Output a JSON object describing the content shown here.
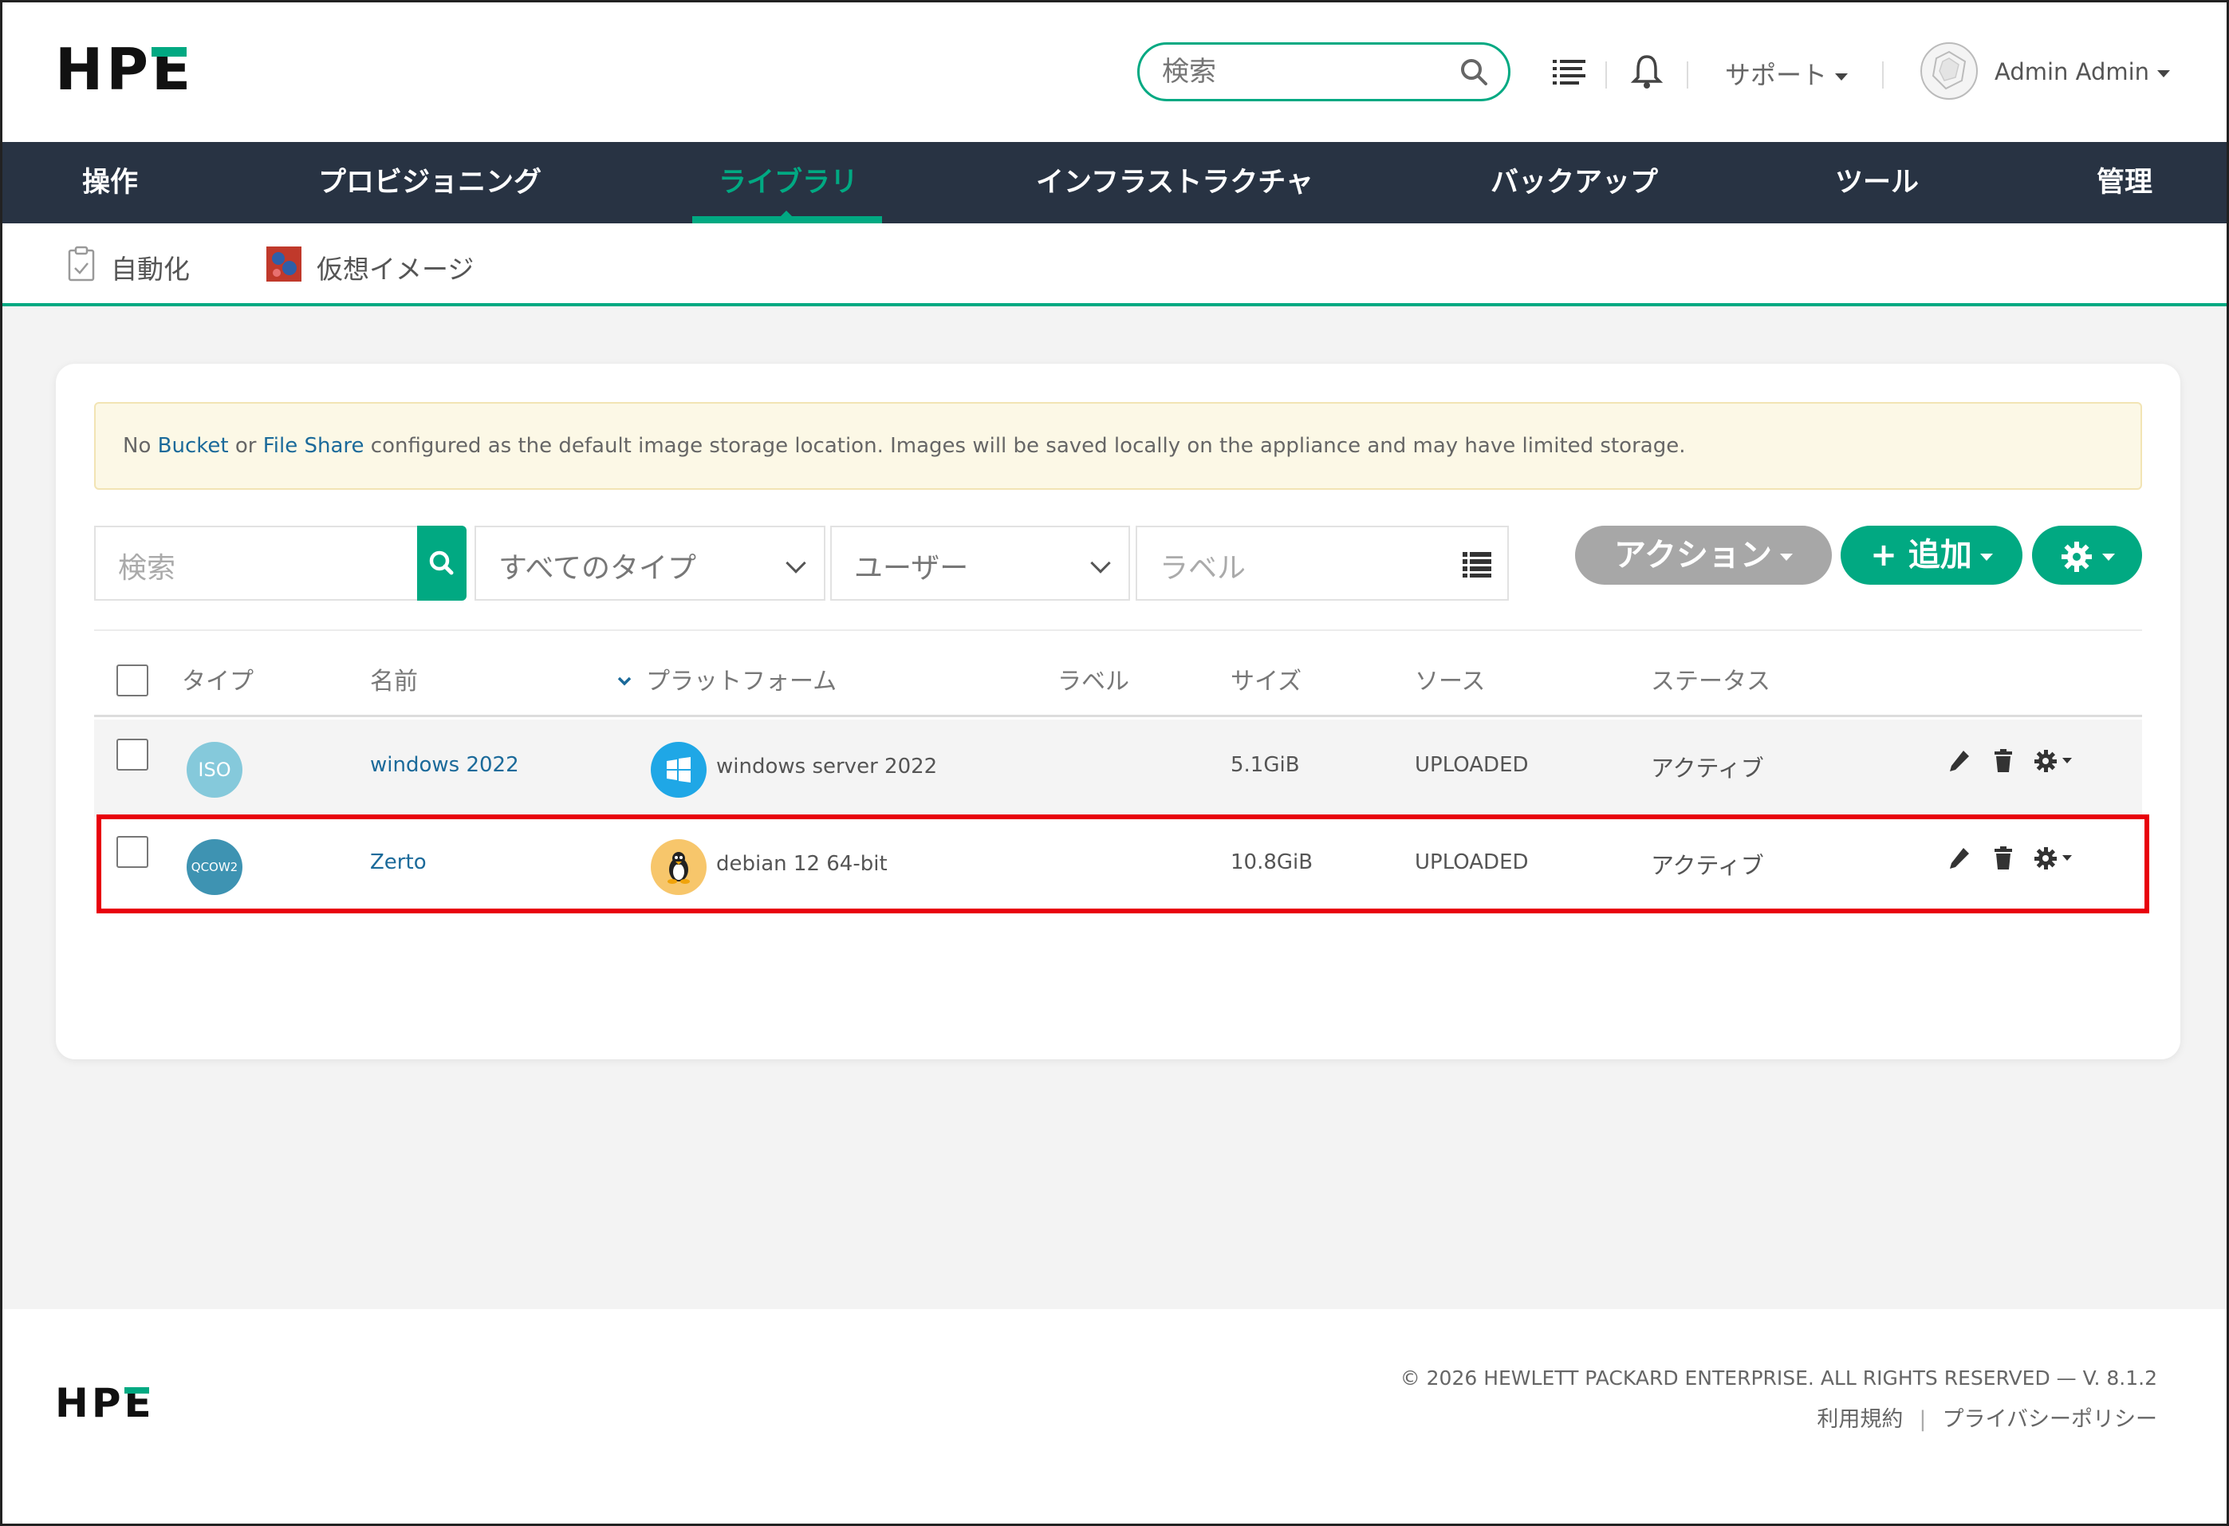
{
  "header": {
    "logo_text": "HPE",
    "search_placeholder": "検索",
    "support_label": "サポート",
    "user_name": "Admin Admin"
  },
  "nav": {
    "items": [
      {
        "label": "操作"
      },
      {
        "label": "プロビジョニング"
      },
      {
        "label": "ライブラリ"
      },
      {
        "label": "インフラストラクチャ"
      },
      {
        "label": "バックアップ"
      },
      {
        "label": "ツール"
      },
      {
        "label": "管理"
      }
    ],
    "active": "ライブラリ"
  },
  "subnav": {
    "items": [
      {
        "label": "自動化",
        "icon": "clipboard-icon"
      },
      {
        "label": "仮想イメージ",
        "icon": "virtual-image-icon"
      }
    ]
  },
  "alert": {
    "prefix": "No ",
    "link1": "Bucket",
    "middle": " or ",
    "link2": "File Share",
    "suffix": " configured as the default image storage location. Images will be saved locally on the appliance and may have limited storage."
  },
  "filters": {
    "search_placeholder": "検索",
    "type_value": "すべてのタイプ",
    "user_value": "ユーザー",
    "label_placeholder": "ラベル"
  },
  "toolbar": {
    "action_label": "アクション",
    "add_label": "+ 追加"
  },
  "table": {
    "headers": {
      "type": "タイプ",
      "name": "名前",
      "platform": "プラットフォーム",
      "label": "ラベル",
      "size": "サイズ",
      "source": "ソース",
      "status": "ステータス"
    },
    "rows": [
      {
        "type_badge": "ISO",
        "type_color": "#85c9db",
        "name": "windows 2022",
        "platform": "windows server 2022",
        "platform_icon": "windows-icon",
        "label": "",
        "size": "5.1GiB",
        "source": "UPLOADED",
        "status": "アクティブ"
      },
      {
        "type_badge": "QCOW2",
        "type_color": "#3e93b2",
        "name": "Zerto",
        "platform": "debian 12 64-bit",
        "platform_icon": "linux-tux-icon",
        "label": "",
        "size": "10.8GiB",
        "source": "UPLOADED",
        "status": "アクティブ"
      }
    ]
  },
  "footer": {
    "logo_text": "HPE",
    "copyright": "© 2026 HEWLETT PACKARD ENTERPRISE. ALL RIGHTS RESERVED — V. 8.1.2",
    "terms": "利用規約",
    "divider": "|",
    "privacy": "プライバシーポリシー"
  },
  "colors": {
    "accent": "#01a982",
    "nav_bg": "#283343",
    "link": "#1b6a9a",
    "highlight": "#e8000b",
    "alert_bg": "#fcf8e6"
  }
}
